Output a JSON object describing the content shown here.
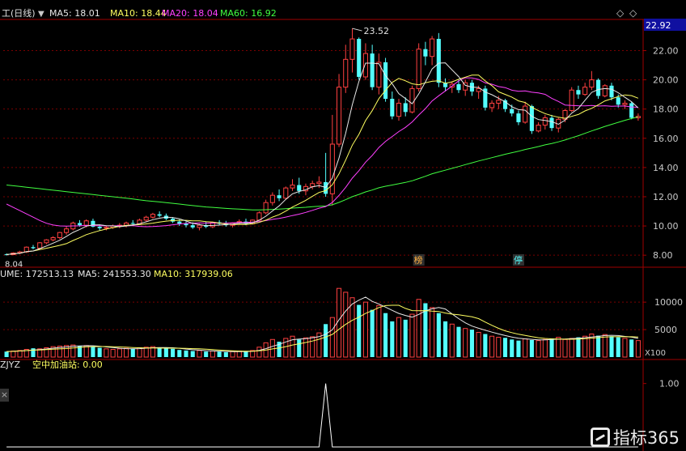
{
  "header": {
    "price_title": "工(日线)",
    "ma5": "MA5: 18.01",
    "ma10": "MA10: 18.44",
    "ma20": "MA20: 18.04",
    "ma60": "MA60: 16.92",
    "volume_title": "UME: 172513.13",
    "vol_ma5": "MA5: 241553.30",
    "vol_ma10": "MA10: 317939.06",
    "indicator_title": "ZJYZ",
    "indicator_value": "空中加油站: 0.00",
    "diamond_icon": "◇",
    "ellipsis_icon": "◇",
    "close_icon": "×"
  },
  "watermark": {
    "text": "指标365"
  },
  "colors": {
    "up": "#ff4040",
    "down": "#54ffff",
    "ma5": "#e8e8e8",
    "ma10": "#ffff60",
    "ma20": "#ff40ff",
    "ma60": "#40ff40",
    "grid": "#7a0000",
    "axis": "#a00000",
    "label": "#c8c8c8",
    "current_price_bg": "#1010a0"
  },
  "chart_data": [
    {
      "type": "candlestick",
      "title": "工(日线)",
      "ylim": [
        7.4,
        23.8
      ],
      "y_ticks": [
        8.0,
        10.0,
        12.0,
        14.0,
        16.0,
        18.0,
        20.0,
        22.0
      ],
      "y_tick_labels": [
        "8.00",
        "10.00",
        "12.00",
        "14.00",
        "16.00",
        "18.00",
        "20.00",
        "22.00"
      ],
      "current_price_label": "22.92",
      "annotations": {
        "high": "23.52",
        "low": "8.04",
        "markers": [
          "榜",
          "停"
        ]
      },
      "ohlc": [
        [
          8.06,
          8.12,
          7.98,
          8.04
        ],
        [
          8.04,
          8.2,
          8.0,
          8.15
        ],
        [
          8.15,
          8.3,
          8.08,
          8.22
        ],
        [
          8.22,
          8.6,
          8.15,
          8.55
        ],
        [
          8.55,
          8.7,
          8.4,
          8.48
        ],
        [
          8.48,
          8.9,
          8.45,
          8.85
        ],
        [
          8.85,
          9.1,
          8.75,
          9.05
        ],
        [
          9.05,
          9.3,
          8.95,
          9.2
        ],
        [
          9.2,
          9.6,
          9.1,
          9.55
        ],
        [
          9.55,
          10.0,
          9.4,
          9.8
        ],
        [
          9.8,
          10.3,
          9.7,
          10.2
        ],
        [
          10.2,
          10.4,
          9.95,
          10.05
        ],
        [
          10.05,
          10.45,
          9.9,
          10.35
        ],
        [
          10.35,
          10.5,
          9.9,
          9.95
        ],
        [
          9.95,
          10.1,
          9.7,
          9.85
        ],
        [
          9.85,
          10.0,
          9.7,
          9.9
        ],
        [
          9.9,
          10.1,
          9.8,
          10.0
        ],
        [
          10.0,
          10.2,
          9.85,
          10.05
        ],
        [
          10.05,
          10.3,
          9.9,
          10.2
        ],
        [
          10.2,
          10.4,
          10.05,
          10.15
        ],
        [
          10.15,
          10.5,
          10.1,
          10.4
        ],
        [
          10.4,
          10.7,
          10.3,
          10.6
        ],
        [
          10.6,
          10.9,
          10.5,
          10.8
        ],
        [
          10.8,
          11.0,
          10.6,
          10.7
        ],
        [
          10.7,
          10.85,
          10.4,
          10.5
        ],
        [
          10.5,
          10.6,
          10.2,
          10.3
        ],
        [
          10.3,
          10.45,
          10.0,
          10.15
        ],
        [
          10.15,
          10.3,
          9.9,
          10.05
        ],
        [
          10.05,
          10.25,
          9.8,
          9.9
        ],
        [
          9.9,
          10.15,
          9.7,
          10.05
        ],
        [
          10.05,
          10.3,
          9.85,
          9.95
        ],
        [
          9.95,
          10.3,
          9.85,
          10.25
        ],
        [
          10.25,
          10.4,
          10.05,
          10.15
        ],
        [
          10.15,
          10.35,
          9.95,
          10.05
        ],
        [
          10.05,
          10.25,
          9.9,
          10.2
        ],
        [
          10.2,
          10.45,
          10.1,
          10.3
        ],
        [
          10.3,
          10.5,
          10.05,
          10.15
        ],
        [
          10.15,
          10.45,
          10.1,
          10.4
        ],
        [
          10.4,
          11.0,
          10.35,
          10.9
        ],
        [
          10.9,
          11.8,
          10.8,
          11.6
        ],
        [
          11.6,
          12.3,
          11.4,
          12.1
        ],
        [
          12.1,
          12.5,
          11.7,
          11.9
        ],
        [
          11.9,
          12.7,
          11.8,
          12.6
        ],
        [
          12.6,
          13.2,
          12.4,
          12.8
        ],
        [
          12.8,
          13.3,
          12.2,
          12.4
        ],
        [
          12.4,
          12.9,
          12.1,
          12.7
        ],
        [
          12.7,
          13.1,
          12.5,
          12.9
        ],
        [
          12.9,
          13.4,
          12.6,
          13.0
        ],
        [
          13.0,
          15.0,
          12.0,
          12.2
        ],
        [
          12.2,
          17.6,
          11.4,
          15.6
        ],
        [
          15.6,
          20.4,
          15.4,
          19.5
        ],
        [
          19.5,
          22.4,
          19.1,
          21.4
        ],
        [
          21.4,
          23.52,
          20.5,
          22.8
        ],
        [
          22.8,
          22.9,
          20.0,
          20.2
        ],
        [
          20.2,
          22.5,
          20.0,
          21.8
        ],
        [
          21.8,
          22.4,
          19.3,
          19.5
        ],
        [
          19.5,
          21.8,
          19.0,
          21.2
        ],
        [
          21.2,
          21.5,
          18.5,
          18.7
        ],
        [
          18.7,
          19.2,
          17.3,
          17.5
        ],
        [
          17.5,
          18.7,
          17.2,
          18.4
        ],
        [
          18.4,
          18.8,
          17.5,
          17.8
        ],
        [
          17.8,
          19.6,
          17.7,
          19.4
        ],
        [
          19.4,
          22.5,
          19.2,
          22.1
        ],
        [
          22.1,
          22.6,
          21.0,
          21.6
        ],
        [
          21.6,
          23.0,
          21.0,
          22.8
        ],
        [
          22.8,
          23.2,
          19.5,
          19.8
        ],
        [
          19.8,
          20.1,
          19.2,
          19.5
        ],
        [
          19.5,
          19.9,
          19.1,
          19.7
        ],
        [
          19.7,
          20.0,
          19.1,
          19.3
        ],
        [
          19.3,
          20.0,
          18.9,
          19.8
        ],
        [
          19.8,
          20.0,
          18.9,
          19.2
        ],
        [
          19.2,
          19.6,
          18.7,
          19.4
        ],
        [
          19.4,
          19.6,
          17.9,
          18.1
        ],
        [
          18.1,
          18.6,
          17.8,
          18.4
        ],
        [
          18.4,
          18.9,
          18.0,
          18.6
        ],
        [
          18.6,
          18.7,
          17.8,
          18.0
        ],
        [
          18.0,
          18.3,
          17.5,
          17.7
        ],
        [
          17.7,
          17.9,
          16.9,
          17.1
        ],
        [
          17.1,
          18.5,
          17.0,
          18.2
        ],
        [
          18.2,
          18.3,
          16.3,
          16.5
        ],
        [
          16.5,
          17.1,
          16.4,
          16.9
        ],
        [
          16.9,
          17.6,
          16.6,
          17.4
        ],
        [
          17.4,
          17.6,
          16.5,
          16.7
        ],
        [
          16.7,
          17.4,
          16.4,
          17.3
        ],
        [
          17.3,
          18.0,
          17.1,
          17.9
        ],
        [
          17.9,
          19.5,
          17.8,
          19.3
        ],
        [
          19.3,
          19.6,
          18.7,
          19.0
        ],
        [
          19.0,
          19.8,
          18.9,
          19.5
        ],
        [
          19.5,
          20.6,
          19.3,
          20.0
        ],
        [
          20.0,
          20.1,
          18.7,
          18.9
        ],
        [
          18.9,
          19.7,
          18.8,
          19.6
        ],
        [
          19.6,
          19.8,
          18.6,
          18.8
        ],
        [
          18.8,
          19.0,
          18.1,
          18.3
        ],
        [
          18.3,
          18.6,
          18.0,
          18.4
        ],
        [
          18.4,
          18.5,
          17.3,
          17.4
        ],
        [
          17.4,
          17.7,
          17.2,
          17.5
        ]
      ]
    },
    {
      "type": "bar",
      "title": "UME: 172513.13",
      "ylim": [
        0,
        14000
      ],
      "y_ticks": [
        5000,
        10000
      ],
      "y_tick_labels": [
        "5000",
        "10000"
      ],
      "unit_label": "X100",
      "values": [
        1000,
        1100,
        1200,
        1400,
        1600,
        1500,
        1700,
        1900,
        2000,
        2100,
        2200,
        2000,
        2100,
        1900,
        1700,
        1500,
        1400,
        1500,
        1600,
        1500,
        1700,
        1800,
        1900,
        1700,
        1600,
        1500,
        1300,
        1200,
        1100,
        1200,
        1000,
        1100,
        1000,
        900,
        1000,
        1100,
        1000,
        1200,
        1800,
        2600,
        3200,
        2800,
        3400,
        3800,
        3200,
        3500,
        3700,
        4400,
        6000,
        7200,
        12500,
        11800,
        10800,
        9500,
        10000,
        8600,
        9400,
        8000,
        6500,
        7200,
        6800,
        7800,
        10500,
        9800,
        9000,
        8000,
        6500,
        6000,
        5500,
        5200,
        5000,
        4500,
        4200,
        3800,
        3600,
        3500,
        3200,
        3000,
        3300,
        3100,
        3000,
        3200,
        3400,
        3600,
        3200,
        3400,
        3600,
        3800,
        4200,
        3900,
        4100,
        3800,
        3600,
        3400,
        3200,
        3000
      ]
    },
    {
      "type": "line",
      "title": "ZJYZ",
      "ylim": [
        0,
        1.2
      ],
      "y_ticks": [
        1.0
      ],
      "y_tick_labels": [
        "1.00"
      ],
      "values": [
        0,
        0,
        0,
        0,
        0,
        0,
        0,
        0,
        0,
        0,
        0,
        0,
        0,
        0,
        0,
        0,
        0,
        0,
        0,
        0,
        0,
        0,
        0,
        0,
        0,
        0,
        0,
        0,
        0,
        0,
        0,
        0,
        0,
        0,
        0,
        0,
        0,
        0,
        0,
        0,
        0,
        0,
        0,
        0,
        0,
        0,
        0,
        0,
        1,
        0,
        0,
        0,
        0,
        0,
        0,
        0,
        0,
        0,
        0,
        0,
        0,
        0,
        0,
        0,
        0,
        0,
        0,
        0,
        0,
        0,
        0,
        0,
        0,
        0,
        0,
        0,
        0,
        0,
        0,
        0,
        0,
        0,
        0,
        0,
        0,
        0,
        0,
        0,
        0,
        0,
        0,
        0,
        0,
        0,
        0,
        0
      ]
    }
  ]
}
